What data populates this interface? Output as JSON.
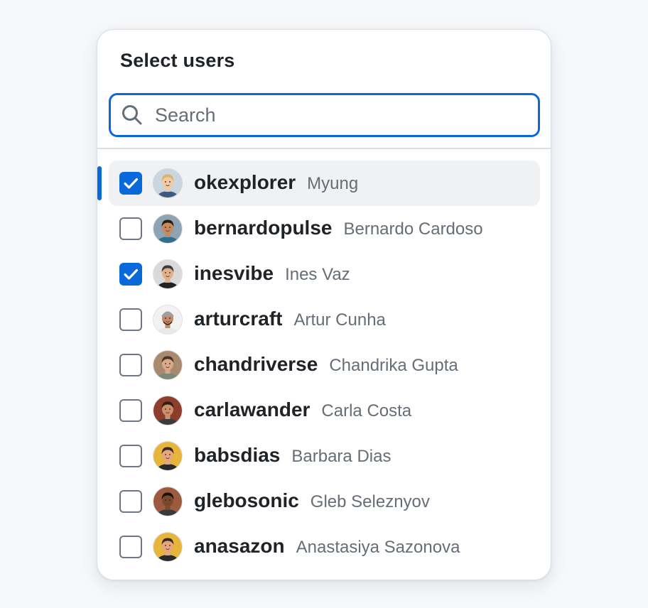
{
  "panel": {
    "title": "Select users",
    "search": {
      "placeholder": "Search",
      "value": ""
    }
  },
  "users": [
    {
      "login": "okexplorer",
      "name": "Myung",
      "checked": true,
      "active": true,
      "avatar": {
        "skin": "#f1c9a5",
        "hair": "#d9b56b",
        "shirt": "#3d5a80",
        "bg": "#c9d6df",
        "hat": false
      }
    },
    {
      "login": "bernardopulse",
      "name": "Bernardo Cardoso",
      "checked": false,
      "active": false,
      "avatar": {
        "skin": "#c68a5f",
        "hair": "#2b1d14",
        "shirt": "#2f6f8f",
        "bg": "#8fa4b2",
        "hat": false
      }
    },
    {
      "login": "inesvibe",
      "name": "Ines Vaz",
      "checked": true,
      "active": false,
      "avatar": {
        "skin": "#e0b08a",
        "hair": "#3b3b3b",
        "shirt": "#222222",
        "bg": "#d9d9d9",
        "hat": false
      }
    },
    {
      "login": "arturcraft",
      "name": "Artur Cunha",
      "checked": false,
      "active": false,
      "avatar": {
        "skin": "#c48a63",
        "hair": "#2a1a10",
        "shirt": "#e9e9e9",
        "bg": "#f2f2f2",
        "hat": true
      }
    },
    {
      "login": "chandriverse",
      "name": "Chandrika Gupta",
      "checked": false,
      "active": false,
      "avatar": {
        "skin": "#d9a98a",
        "hair": "#4a3526",
        "shirt": "#7a8a7a",
        "bg": "#a98a6f",
        "hat": false
      }
    },
    {
      "login": "carlawander",
      "name": "Carla Costa",
      "checked": false,
      "active": false,
      "avatar": {
        "skin": "#c9906a",
        "hair": "#2d1e14",
        "shirt": "#3c3c3c",
        "bg": "#8c3d2b",
        "hat": false
      }
    },
    {
      "login": "babsdias",
      "name": "Barbara Dias",
      "checked": false,
      "active": false,
      "avatar": {
        "skin": "#e4a57f",
        "hair": "#3a2a1c",
        "shirt": "#2a2a2a",
        "bg": "#e7b43c",
        "hat": false
      }
    },
    {
      "login": "glebosonic",
      "name": "Gleb Seleznyov",
      "checked": false,
      "active": false,
      "avatar": {
        "skin": "#7a4a2e",
        "hair": "#1a120c",
        "shirt": "#3a3a3a",
        "bg": "#9e5a3f",
        "hat": false
      }
    },
    {
      "login": "anasazon",
      "name": "Anastasiya Sazonova",
      "checked": false,
      "active": false,
      "avatar": {
        "skin": "#e4a57f",
        "hair": "#3a2a1c",
        "shirt": "#2a2a2a",
        "bg": "#e7b43c",
        "hat": false
      }
    }
  ]
}
